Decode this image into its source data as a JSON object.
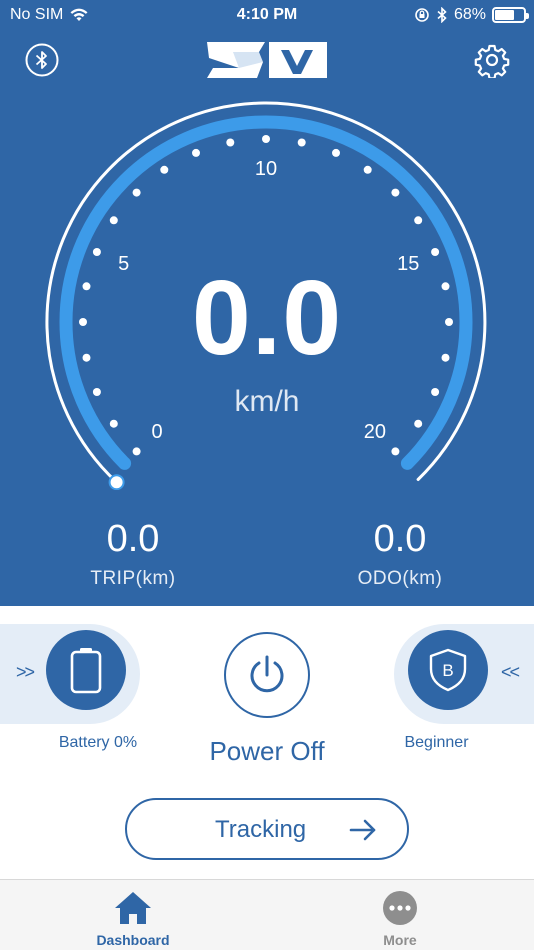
{
  "status_bar": {
    "carrier": "No SIM",
    "time": "4:10 PM",
    "battery_percent": "68%",
    "battery_level": 0.68
  },
  "header": {
    "logo_text": "SW",
    "left_icon": "bluetooth-icon",
    "right_icon": "gear-icon"
  },
  "gauge": {
    "min": 0,
    "max": 20,
    "tick_labels": [
      "0",
      "5",
      "10",
      "15",
      "20"
    ],
    "value": 0.0,
    "speed_display": "0.0",
    "unit": "km/h"
  },
  "stats": {
    "trip_value": "0.0",
    "trip_label": "TRIP(km)",
    "odo_value": "0.0",
    "odo_label": "ODO(km)"
  },
  "controls": {
    "left_chevron": ">>",
    "right_chevron": "<<",
    "battery_label": "Battery 0%",
    "battery_level": 0,
    "power_label": "Power Off",
    "mode_label": "Beginner",
    "mode_letter": "B",
    "tracking_label": "Tracking"
  },
  "tabbar": {
    "tabs": [
      {
        "label": "Dashboard",
        "icon": "home-icon",
        "active": true
      },
      {
        "label": "More",
        "icon": "more-icon",
        "active": false
      }
    ]
  },
  "colors": {
    "primary": "#2f66a6",
    "arc_accent": "#3d9be9",
    "white": "#ffffff",
    "band": "#e4edf7"
  }
}
